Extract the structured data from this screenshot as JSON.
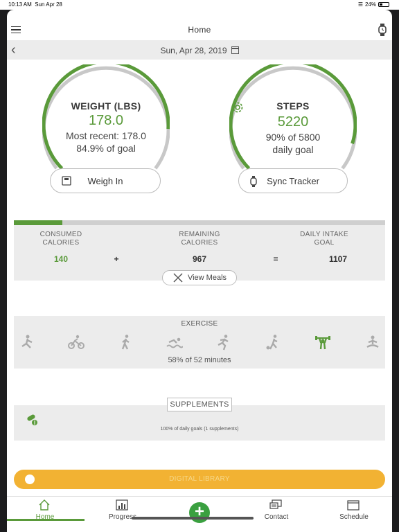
{
  "status": {
    "time": "10:13 AM",
    "date": "Sun Apr 28",
    "battery": "24%"
  },
  "header": {
    "title": "Home",
    "menu_icon": "hamburger-icon",
    "tracker_icon": "watch-icon"
  },
  "datebar": {
    "date": "Sun, Apr 28, 2019",
    "back_icon": "chevron-left-icon",
    "calendar_icon": "calendar-icon"
  },
  "weight": {
    "title": "WEIGHT (LBS)",
    "value": "178.0",
    "recent": "Most recent: 178.0",
    "goal": "84.9% of goal",
    "progress": 0.849,
    "button": "Weigh In"
  },
  "steps": {
    "title": "STEPS",
    "value": "5220",
    "goal_line1": "90% of 5800",
    "goal_line2": "daily goal",
    "progress": 0.9,
    "button": "Sync Tracker",
    "settings_icon": "gear-icon"
  },
  "calories": {
    "progress": 0.13,
    "consumed_label": "CONSUMED\nCALORIES",
    "remaining_label": "REMAINING\nCALORIES",
    "goal_label": "DAILY INTAKE\nGOAL",
    "consumed": "140",
    "plus": "+",
    "remaining": "967",
    "equals": "=",
    "goal": "1107",
    "view_meals": "View Meals"
  },
  "exercise": {
    "label": "EXERCISE",
    "summary": "58% of 52 minutes",
    "icons": [
      "strength-icon",
      "cycling-icon",
      "walking-icon",
      "swimming-icon",
      "running-icon",
      "sports-icon",
      "weightlifting-icon",
      "yoga-icon"
    ],
    "active_index": 6
  },
  "supplements": {
    "label": "SUPPLEMENTS",
    "summary": "100% of daily goals (1 supplements)",
    "icon": "pill-icon"
  },
  "library": {
    "label": "DIGITAL LIBRARY"
  },
  "tabs": [
    {
      "label": "Home",
      "icon": "home-icon"
    },
    {
      "label": "Progress",
      "icon": "chart-icon"
    },
    {
      "label": "Contact",
      "icon": "chat-icon"
    },
    {
      "label": "Schedule",
      "icon": "calendar-icon"
    }
  ],
  "colors": {
    "green": "#5a9a3a",
    "gray_track": "#c8c8c8",
    "library": "#f2b233",
    "panel": "#ececec"
  }
}
